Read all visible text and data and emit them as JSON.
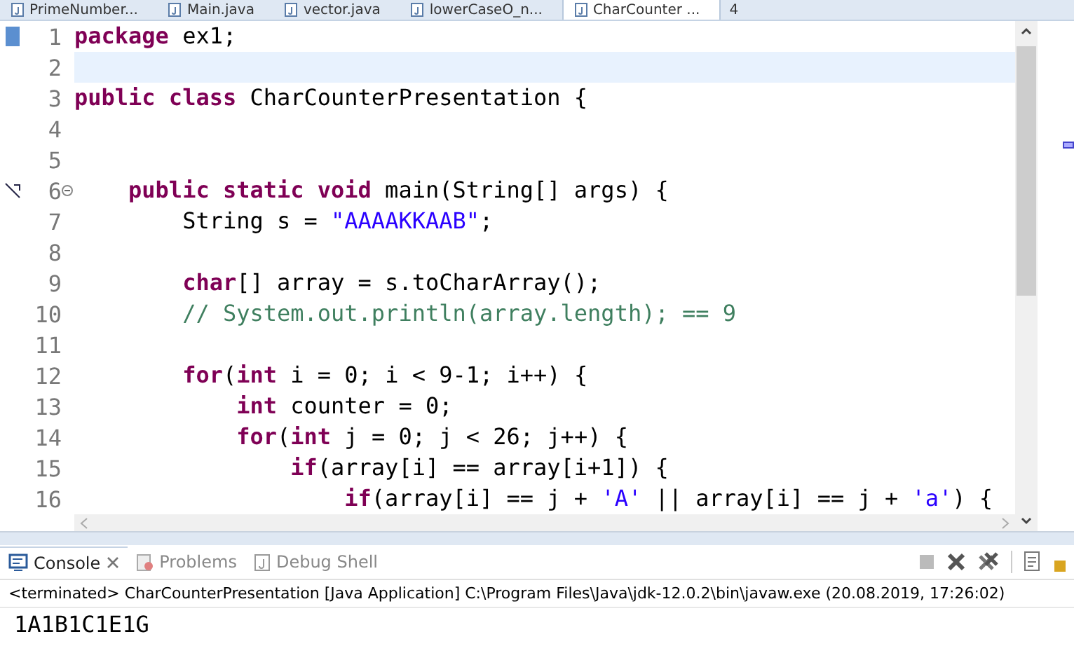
{
  "editor_tabs": [
    {
      "label": "PrimeNumber...",
      "selected": false
    },
    {
      "label": "Main.java",
      "selected": false
    },
    {
      "label": "vector.java",
      "selected": false
    },
    {
      "label": "lowerCaseO_n...",
      "selected": false
    },
    {
      "label": "CharCounter ...",
      "selected": true
    }
  ],
  "overflow_count": "4",
  "code_lines": [
    {
      "number": "1",
      "current": false,
      "tokens": [
        {
          "kind": "keyword",
          "text": "package"
        },
        {
          "kind": "plain",
          "text": " ex1;"
        }
      ]
    },
    {
      "number": "2",
      "current": true
    },
    {
      "number": "3",
      "current": false,
      "tokens": [
        {
          "kind": "keyword",
          "text": "public class"
        },
        {
          "kind": "plain",
          "text": " CharCounterPresentation {"
        }
      ]
    },
    {
      "number": "4",
      "current": false
    },
    {
      "number": "5",
      "current": false
    },
    {
      "number": "6",
      "current": false,
      "tokens": [
        {
          "kind": "keyword",
          "text": "    public static void"
        },
        {
          "kind": "plain",
          "text": " main(String[] args) {"
        }
      ]
    },
    {
      "number": "7",
      "current": false,
      "tokens": [
        {
          "kind": "plain",
          "text": "        String s = "
        },
        {
          "kind": "string",
          "text": "\"AAAAKKAAB\""
        },
        {
          "kind": "plain",
          "text": ";"
        }
      ]
    },
    {
      "number": "8",
      "current": false
    },
    {
      "number": "9",
      "current": false,
      "tokens": [
        {
          "kind": "keyword",
          "text": "        char"
        },
        {
          "kind": "plain",
          "text": "[] array = s.toCharArray();"
        }
      ]
    },
    {
      "number": "10",
      "current": false,
      "tokens": [
        {
          "kind": "comment",
          "text": "        // System.out.println(array.length); == 9"
        }
      ]
    },
    {
      "number": "11",
      "current": false
    },
    {
      "number": "12",
      "current": false,
      "tokens": [
        {
          "kind": "keyword",
          "text": "        for"
        },
        {
          "kind": "plain",
          "text": "("
        },
        {
          "kind": "keyword",
          "text": "int"
        },
        {
          "kind": "plain",
          "text": " i = 0; i < 9-1; i++) {"
        }
      ]
    },
    {
      "number": "13",
      "current": false,
      "tokens": [
        {
          "kind": "keyword",
          "text": "            int"
        },
        {
          "kind": "plain",
          "text": " counter = 0;"
        }
      ]
    },
    {
      "number": "14",
      "current": false,
      "tokens": [
        {
          "kind": "keyword",
          "text": "            for"
        },
        {
          "kind": "plain",
          "text": "("
        },
        {
          "kind": "keyword",
          "text": "int"
        },
        {
          "kind": "plain",
          "text": " j = 0; j < 26; j++) {"
        }
      ]
    },
    {
      "number": "15",
      "current": false,
      "tokens": [
        {
          "kind": "keyword",
          "text": "                if"
        },
        {
          "kind": "plain",
          "text": "(array[i] == array[i+1]) {"
        }
      ]
    },
    {
      "number": "16",
      "current": false,
      "tokens": [
        {
          "kind": "keyword",
          "text": "                    if"
        },
        {
          "kind": "plain",
          "text": "(array[i] == j + "
        },
        {
          "kind": "string",
          "text": "'A'"
        },
        {
          "kind": "plain",
          "text": " || array[i] == j + "
        },
        {
          "kind": "string",
          "text": "'a'"
        },
        {
          "kind": "plain",
          "text": ") {"
        }
      ]
    }
  ],
  "console_tabs": [
    {
      "label": "Console",
      "selected": true
    },
    {
      "label": "Problems",
      "selected": false
    },
    {
      "label": "Debug Shell",
      "selected": false
    }
  ],
  "console": {
    "header": "<terminated> CharCounterPresentation [Java Application] C:\\Program Files\\Java\\jdk-12.0.2\\bin\\javaw.exe (20.08.2019, 17:26:02)",
    "output": "1A1B1C1E1G"
  }
}
